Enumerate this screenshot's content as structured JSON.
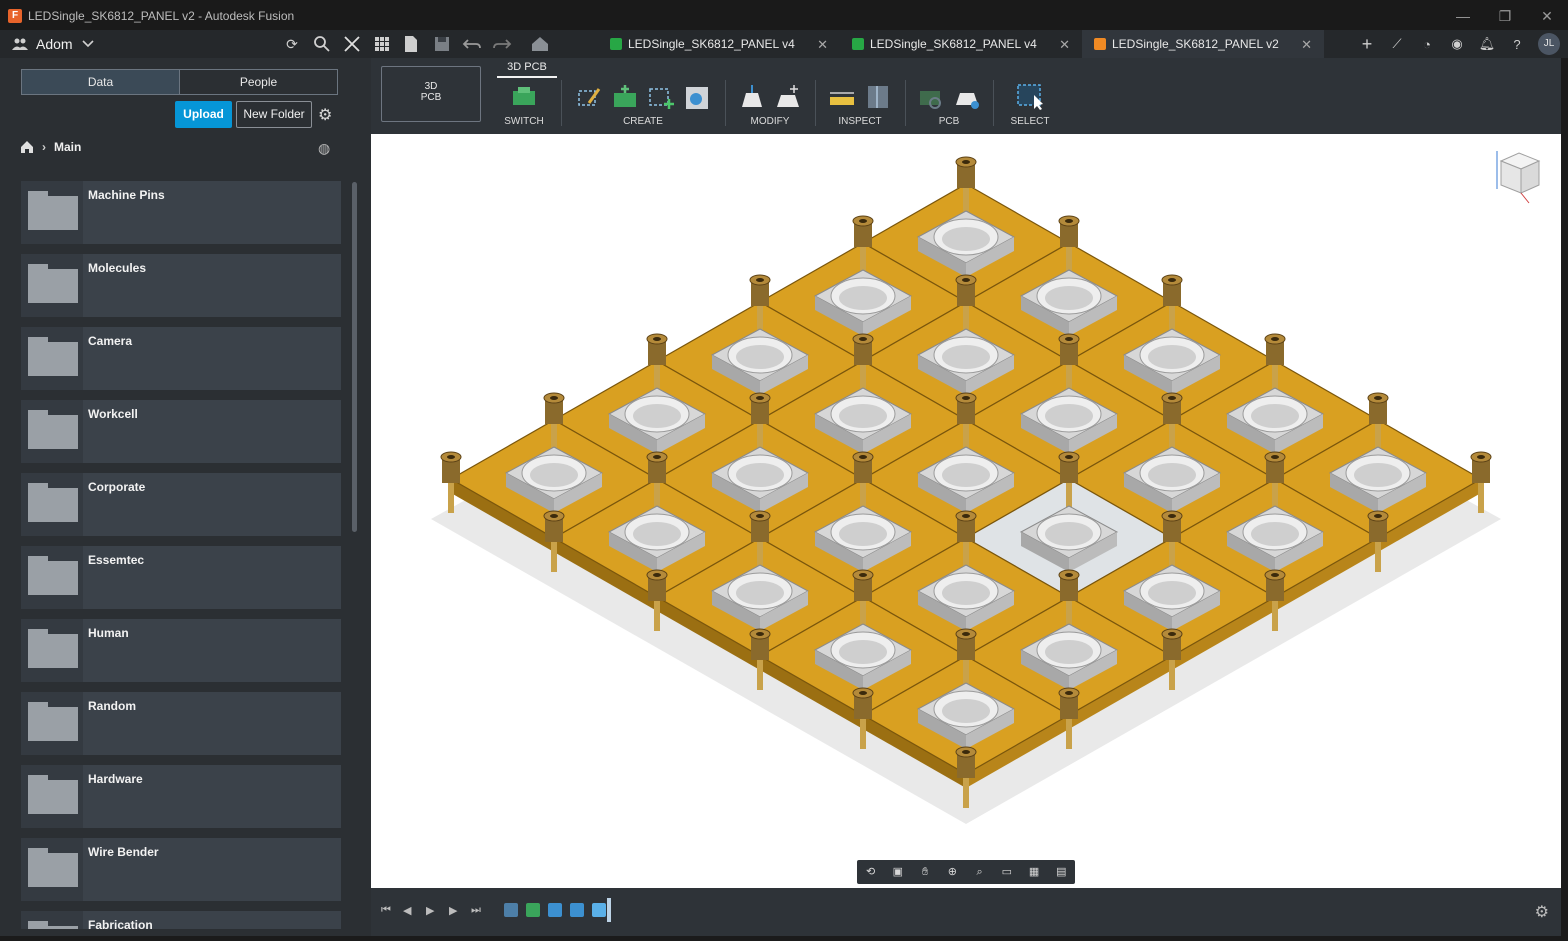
{
  "window": {
    "title": "LEDSingle_SK6812_PANEL v2 - Autodesk Fusion",
    "logo_letter": "F",
    "controls": {
      "minimize": "—",
      "maximize": "❐",
      "close": "✕"
    }
  },
  "appbar": {
    "team_name": "Adom",
    "doc_tabs": [
      {
        "label": "LEDSingle_SK6812_PANEL v4",
        "icon_color": "#27a745",
        "close": "✕"
      },
      {
        "label": "LEDSingle_SK6812_PANEL v4",
        "icon_color": "#27a745",
        "close": "✕"
      },
      {
        "label": "LEDSingle_SK6812_PANEL v2",
        "icon_color": "#f08a24",
        "close": "✕"
      }
    ],
    "new_tab": "+",
    "user_initials": "JL"
  },
  "data_panel": {
    "tabs": [
      "Data",
      "People"
    ],
    "upload_label": "Upload",
    "new_folder_label": "New Folder",
    "breadcrumb": "Main",
    "folders": [
      "Machine Pins",
      "Molecules",
      "Camera",
      "Workcell",
      "Corporate",
      "Essemtec",
      "Human",
      "Random",
      "Hardware",
      "Wire Bender",
      "Fabrication"
    ]
  },
  "toolbar": {
    "workspace_label_line1": "3D",
    "workspace_label_line2": "PCB",
    "active_tab": "3D PCB",
    "groups": [
      "SWITCH",
      "CREATE",
      "MODIFY",
      "INSPECT",
      "PCB",
      "SELECT"
    ]
  },
  "colors": {
    "accent": "#0696d7",
    "board": "#d9a021",
    "pin": "#8a6a2c",
    "led": "#d7d7d7"
  }
}
